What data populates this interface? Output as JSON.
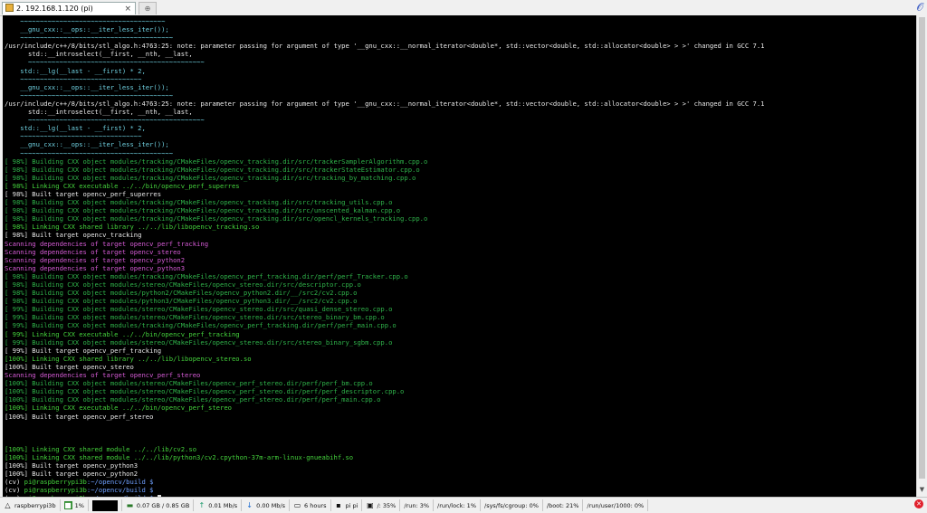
{
  "tab": {
    "title": "2. 192.168.1.120 (pi)",
    "close": "×"
  },
  "terminal_lines": [
    {
      "t": "    ~~~~~~~~~~~~~~~~~~~~~~~~~~~~~~~~~~~~~",
      "c": "c"
    },
    {
      "t": "    __gnu_cxx::__ops::__iter_less_iter());",
      "c": "c"
    },
    {
      "t": "    ~~~~~~~~~~~~~~~~~~~~~~~~~~~~~~~~~~~~~~~",
      "c": "c"
    },
    {
      "t": "/usr/include/c++/8/bits/stl_algo.h:4763:25: note: parameter passing for argument of type '__gnu_cxx::__normal_iterator<double*, std::vector<double, std::allocator<double> > >' changed in GCC 7.1",
      "c": "w"
    },
    {
      "t": "      std::__introselect(__first, __nth, __last,",
      "c": "w"
    },
    {
      "t": "      ~~~~~~~~~~~~~~~~~~~~~~~~~~~~~~~~~~~~~~~~~~~~~",
      "c": "c"
    },
    {
      "t": "    std::__lg(__last - __first) * 2,",
      "c": "c"
    },
    {
      "t": "    ~~~~~~~~~~~~~~~~~~~~~~~~~~~~~~~",
      "c": "c"
    },
    {
      "t": "    __gnu_cxx::__ops::__iter_less_iter());",
      "c": "c"
    },
    {
      "t": "    ~~~~~~~~~~~~~~~~~~~~~~~~~~~~~~~~~~~~~~~",
      "c": "c"
    },
    {
      "t": "/usr/include/c++/8/bits/stl_algo.h:4763:25: note: parameter passing for argument of type '__gnu_cxx::__normal_iterator<double*, std::vector<double, std::allocator<double> > >' changed in GCC 7.1",
      "c": "w"
    },
    {
      "t": "      std::__introselect(__first, __nth, __last,",
      "c": "w"
    },
    {
      "t": "      ~~~~~~~~~~~~~~~~~~~~~~~~~~~~~~~~~~~~~~~~~~~~~",
      "c": "c"
    },
    {
      "t": "    std::__lg(__last - __first) * 2,",
      "c": "c"
    },
    {
      "t": "    ~~~~~~~~~~~~~~~~~~~~~~~~~~~~~~~",
      "c": "c"
    },
    {
      "t": "    __gnu_cxx::__ops::__iter_less_iter());",
      "c": "c"
    },
    {
      "t": "    ~~~~~~~~~~~~~~~~~~~~~~~~~~~~~~~~~~~~~~~",
      "c": "c"
    },
    {
      "t": "[ 98%] Building CXX object modules/tracking/CMakeFiles/opencv_tracking.dir/src/trackerSamplerAlgorithm.cpp.o",
      "c": "g"
    },
    {
      "t": "[ 98%] Building CXX object modules/tracking/CMakeFiles/opencv_tracking.dir/src/trackerStateEstimator.cpp.o",
      "c": "g"
    },
    {
      "t": "[ 98%] Building CXX object modules/tracking/CMakeFiles/opencv_tracking.dir/src/tracking_by_matching.cpp.o",
      "c": "g"
    },
    {
      "t": "[ 98%] Linking CXX executable ../../bin/opencv_perf_superres",
      "c": "gb"
    },
    {
      "t": "[ 98%] Built target opencv_perf_superres",
      "c": "w"
    },
    {
      "t": "[ 98%] Building CXX object modules/tracking/CMakeFiles/opencv_tracking.dir/src/tracking_utils.cpp.o",
      "c": "g"
    },
    {
      "t": "[ 98%] Building CXX object modules/tracking/CMakeFiles/opencv_tracking.dir/src/unscented_kalman.cpp.o",
      "c": "g"
    },
    {
      "t": "[ 98%] Building CXX object modules/tracking/CMakeFiles/opencv_tracking.dir/src/opencl_kernels_tracking.cpp.o",
      "c": "g"
    },
    {
      "t": "[ 98%] Linking CXX shared library ../../lib/libopencv_tracking.so",
      "c": "gb"
    },
    {
      "t": "[ 98%] Built target opencv_tracking",
      "c": "w"
    },
    {
      "t": "Scanning dependencies of target opencv_perf_tracking",
      "c": "m"
    },
    {
      "t": "Scanning dependencies of target opencv_stereo",
      "c": "m"
    },
    {
      "t": "Scanning dependencies of target opencv_python2",
      "c": "m"
    },
    {
      "t": "Scanning dependencies of target opencv_python3",
      "c": "m"
    },
    {
      "t": "[ 98%] Building CXX object modules/tracking/CMakeFiles/opencv_perf_tracking.dir/perf/perf_Tracker.cpp.o",
      "c": "g"
    },
    {
      "t": "[ 98%] Building CXX object modules/stereo/CMakeFiles/opencv_stereo.dir/src/descriptor.cpp.o",
      "c": "g"
    },
    {
      "t": "[ 98%] Building CXX object modules/python2/CMakeFiles/opencv_python2.dir/__/src2/cv2.cpp.o",
      "c": "g"
    },
    {
      "t": "[ 98%] Building CXX object modules/python3/CMakeFiles/opencv_python3.dir/__/src2/cv2.cpp.o",
      "c": "g"
    },
    {
      "t": "[ 99%] Building CXX object modules/stereo/CMakeFiles/opencv_stereo.dir/src/quasi_dense_stereo.cpp.o",
      "c": "g"
    },
    {
      "t": "[ 99%] Building CXX object modules/stereo/CMakeFiles/opencv_stereo.dir/src/stereo_binary_bm.cpp.o",
      "c": "g"
    },
    {
      "t": "[ 99%] Building CXX object modules/tracking/CMakeFiles/opencv_perf_tracking.dir/perf/perf_main.cpp.o",
      "c": "g"
    },
    {
      "t": "[ 99%] Linking CXX executable ../../bin/opencv_perf_tracking",
      "c": "gb"
    },
    {
      "t": "[ 99%] Building CXX object modules/stereo/CMakeFiles/opencv_stereo.dir/src/stereo_binary_sgbm.cpp.o",
      "c": "g"
    },
    {
      "t": "[ 99%] Built target opencv_perf_tracking",
      "c": "w"
    },
    {
      "t": "[100%] Linking CXX shared library ../../lib/libopencv_stereo.so",
      "c": "gb"
    },
    {
      "t": "[100%] Built target opencv_stereo",
      "c": "w"
    },
    {
      "t": "Scanning dependencies of target opencv_perf_stereo",
      "c": "m"
    },
    {
      "t": "[100%] Building CXX object modules/stereo/CMakeFiles/opencv_perf_stereo.dir/perf/perf_bm.cpp.o",
      "c": "g"
    },
    {
      "t": "[100%] Building CXX object modules/stereo/CMakeFiles/opencv_perf_stereo.dir/perf/perf_descriptor.cpp.o",
      "c": "g"
    },
    {
      "t": "[100%] Building CXX object modules/stereo/CMakeFiles/opencv_perf_stereo.dir/perf/perf_main.cpp.o",
      "c": "g"
    },
    {
      "t": "[100%] Linking CXX executable ../../bin/opencv_perf_stereo",
      "c": "gb"
    },
    {
      "t": "[100%] Built target opencv_perf_stereo",
      "c": "w"
    },
    {
      "t": "",
      "c": "w"
    },
    {
      "t": "",
      "c": "w"
    },
    {
      "t": "",
      "c": "w"
    },
    {
      "t": "[100%] Linking CXX shared module ../../lib/cv2.so",
      "c": "gb"
    },
    {
      "t": "[100%] Linking CXX shared module ../../lib/python3/cv2.cpython-37m-arm-linux-gnueabihf.so",
      "c": "gb"
    },
    {
      "t": "[100%] Built target opencv_python3",
      "c": "w"
    },
    {
      "t": "[100%] Built target opencv_python2",
      "c": "w"
    }
  ],
  "prompt_lines": [
    {
      "env": "(cv) ",
      "user": "pi@raspberrypi3b",
      "path": ":~/opencv/build $"
    },
    {
      "env": "(cv) ",
      "user": "pi@raspberrypi3b",
      "path": ":~/opencv/build $"
    },
    {
      "env": "(cv) ",
      "user": "pi@raspberrypi3b",
      "path": ":~/opencv/build $ "
    }
  ],
  "status": {
    "host": "raspberrypi3b",
    "cpu": "1%",
    "mem": "0.07 GB / 0.85 GB",
    "upload": "0.01 Mb/s",
    "download": "0.00 Mb/s",
    "uptime": "6 hours",
    "user": "pi  pi",
    "fs_root": "/: 35%",
    "fs_run": "/run: 3%",
    "fs_runlock": "/run/lock: 1%",
    "fs_cgroup": "/sys/fs/cgroup: 0%",
    "fs_boot": "/boot: 21%",
    "fs_runuser": "/run/user/1000: 0%"
  },
  "colors": {
    "prompt_green": "#44d23c",
    "prompt_blue": "#6fa0ff",
    "terminal_bg": "#000000",
    "build_green": "#2fb34a",
    "scan_magenta": "#d65bd6"
  }
}
